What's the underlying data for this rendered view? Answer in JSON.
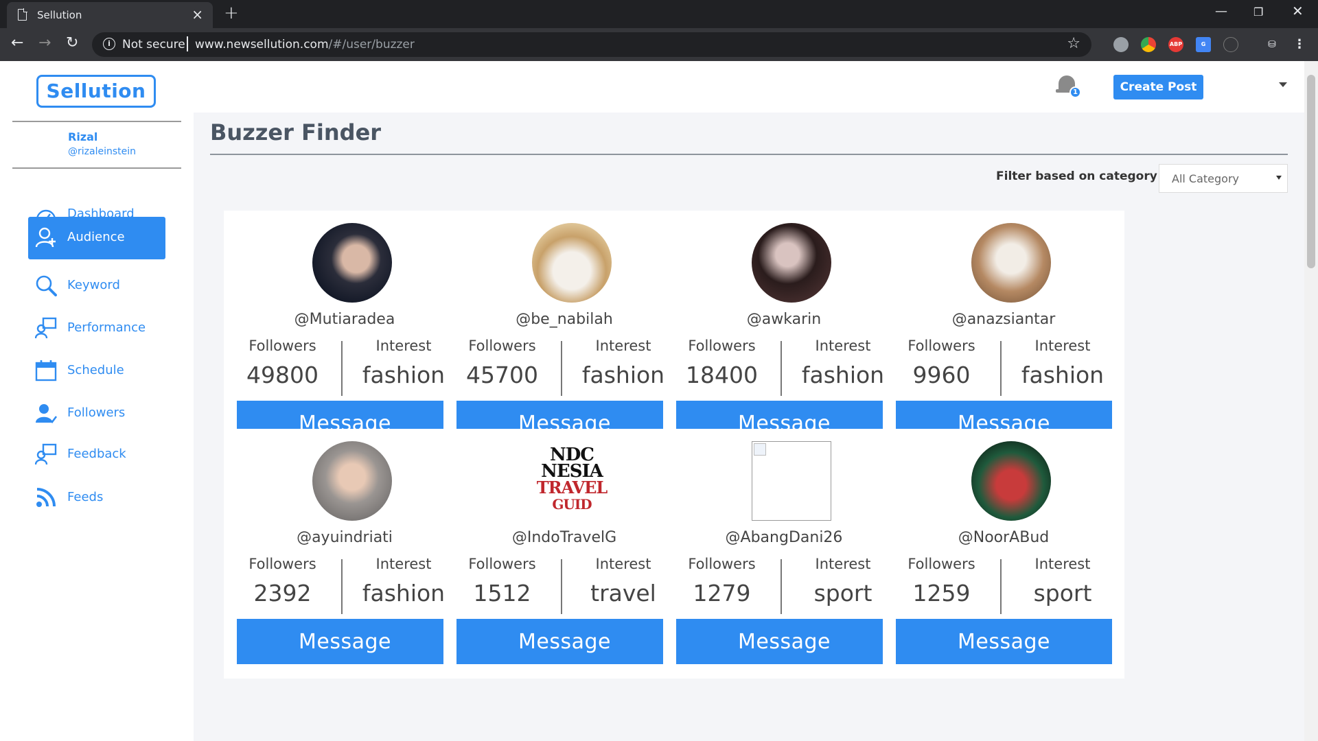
{
  "browser": {
    "tab_title": "Sellution",
    "not_secure": "Not secure",
    "url_host": "www.newsellution.com",
    "url_path": "/#/user/buzzer"
  },
  "app": {
    "logo": "Sellution",
    "notification_count": "1",
    "create_post_label": "Create Post"
  },
  "user": {
    "name": "Rizal",
    "handle": "@rizaleinstein"
  },
  "sidebar": {
    "items": [
      {
        "label": "Dashboard",
        "icon": "dashboard-icon"
      },
      {
        "label": "Audience",
        "icon": "audience-icon",
        "active": true
      },
      {
        "label": "Keyword",
        "icon": "search-icon"
      },
      {
        "label": "Performance",
        "icon": "performance-icon"
      },
      {
        "label": "Schedule",
        "icon": "calendar-icon"
      },
      {
        "label": "Followers",
        "icon": "followers-icon"
      },
      {
        "label": "Feedback",
        "icon": "feedback-icon"
      },
      {
        "label": "Feeds",
        "icon": "rss-icon"
      }
    ]
  },
  "main": {
    "title": "Buzzer Finder",
    "filter_label": "Filter based on category",
    "filter_value": "All Category",
    "followers_label": "Followers",
    "interest_label": "Interest",
    "message_label": "Message",
    "buzzers": [
      {
        "handle": "@Mutiaradea",
        "followers": "49800",
        "interest": "fashion"
      },
      {
        "handle": "@be_nabilah",
        "followers": "45700",
        "interest": "fashion"
      },
      {
        "handle": "@awkarin",
        "followers": "18400",
        "interest": "fashion"
      },
      {
        "handle": "@anazsiantar",
        "followers": "9960",
        "interest": "fashion"
      },
      {
        "handle": "@ayuindriati",
        "followers": "2392",
        "interest": "fashion"
      },
      {
        "handle": "@IndoTravelG",
        "followers": "1512",
        "interest": "travel",
        "logo_text": [
          "NDC",
          "NESIA",
          "TRAVEL",
          "GUID"
        ]
      },
      {
        "handle": "@AbangDani26",
        "followers": "1279",
        "interest": "sport",
        "broken_image": true
      },
      {
        "handle": "@NoorABud",
        "followers": "1259",
        "interest": "sport"
      }
    ]
  },
  "colors": {
    "accent": "#2f8cf1",
    "main_bg": "#f4f5f8",
    "text": "#444444"
  }
}
